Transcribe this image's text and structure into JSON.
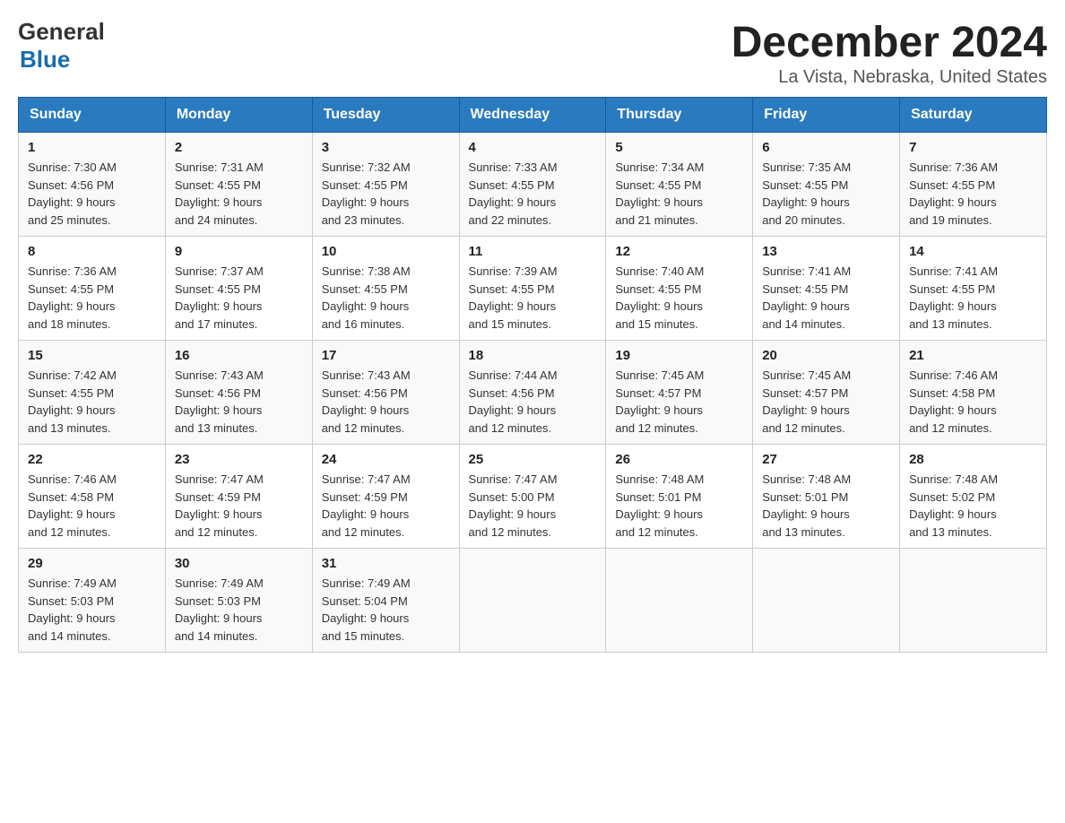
{
  "header": {
    "logo_general": "General",
    "logo_blue": "Blue",
    "month_title": "December 2024",
    "location": "La Vista, Nebraska, United States"
  },
  "days_of_week": [
    "Sunday",
    "Monday",
    "Tuesday",
    "Wednesday",
    "Thursday",
    "Friday",
    "Saturday"
  ],
  "weeks": [
    [
      {
        "day": "1",
        "sunrise": "7:30 AM",
        "sunset": "4:56 PM",
        "daylight": "9 hours and 25 minutes."
      },
      {
        "day": "2",
        "sunrise": "7:31 AM",
        "sunset": "4:55 PM",
        "daylight": "9 hours and 24 minutes."
      },
      {
        "day": "3",
        "sunrise": "7:32 AM",
        "sunset": "4:55 PM",
        "daylight": "9 hours and 23 minutes."
      },
      {
        "day": "4",
        "sunrise": "7:33 AM",
        "sunset": "4:55 PM",
        "daylight": "9 hours and 22 minutes."
      },
      {
        "day": "5",
        "sunrise": "7:34 AM",
        "sunset": "4:55 PM",
        "daylight": "9 hours and 21 minutes."
      },
      {
        "day": "6",
        "sunrise": "7:35 AM",
        "sunset": "4:55 PM",
        "daylight": "9 hours and 20 minutes."
      },
      {
        "day": "7",
        "sunrise": "7:36 AM",
        "sunset": "4:55 PM",
        "daylight": "9 hours and 19 minutes."
      }
    ],
    [
      {
        "day": "8",
        "sunrise": "7:36 AM",
        "sunset": "4:55 PM",
        "daylight": "9 hours and 18 minutes."
      },
      {
        "day": "9",
        "sunrise": "7:37 AM",
        "sunset": "4:55 PM",
        "daylight": "9 hours and 17 minutes."
      },
      {
        "day": "10",
        "sunrise": "7:38 AM",
        "sunset": "4:55 PM",
        "daylight": "9 hours and 16 minutes."
      },
      {
        "day": "11",
        "sunrise": "7:39 AM",
        "sunset": "4:55 PM",
        "daylight": "9 hours and 15 minutes."
      },
      {
        "day": "12",
        "sunrise": "7:40 AM",
        "sunset": "4:55 PM",
        "daylight": "9 hours and 15 minutes."
      },
      {
        "day": "13",
        "sunrise": "7:41 AM",
        "sunset": "4:55 PM",
        "daylight": "9 hours and 14 minutes."
      },
      {
        "day": "14",
        "sunrise": "7:41 AM",
        "sunset": "4:55 PM",
        "daylight": "9 hours and 13 minutes."
      }
    ],
    [
      {
        "day": "15",
        "sunrise": "7:42 AM",
        "sunset": "4:55 PM",
        "daylight": "9 hours and 13 minutes."
      },
      {
        "day": "16",
        "sunrise": "7:43 AM",
        "sunset": "4:56 PM",
        "daylight": "9 hours and 13 minutes."
      },
      {
        "day": "17",
        "sunrise": "7:43 AM",
        "sunset": "4:56 PM",
        "daylight": "9 hours and 12 minutes."
      },
      {
        "day": "18",
        "sunrise": "7:44 AM",
        "sunset": "4:56 PM",
        "daylight": "9 hours and 12 minutes."
      },
      {
        "day": "19",
        "sunrise": "7:45 AM",
        "sunset": "4:57 PM",
        "daylight": "9 hours and 12 minutes."
      },
      {
        "day": "20",
        "sunrise": "7:45 AM",
        "sunset": "4:57 PM",
        "daylight": "9 hours and 12 minutes."
      },
      {
        "day": "21",
        "sunrise": "7:46 AM",
        "sunset": "4:58 PM",
        "daylight": "9 hours and 12 minutes."
      }
    ],
    [
      {
        "day": "22",
        "sunrise": "7:46 AM",
        "sunset": "4:58 PM",
        "daylight": "9 hours and 12 minutes."
      },
      {
        "day": "23",
        "sunrise": "7:47 AM",
        "sunset": "4:59 PM",
        "daylight": "9 hours and 12 minutes."
      },
      {
        "day": "24",
        "sunrise": "7:47 AM",
        "sunset": "4:59 PM",
        "daylight": "9 hours and 12 minutes."
      },
      {
        "day": "25",
        "sunrise": "7:47 AM",
        "sunset": "5:00 PM",
        "daylight": "9 hours and 12 minutes."
      },
      {
        "day": "26",
        "sunrise": "7:48 AM",
        "sunset": "5:01 PM",
        "daylight": "9 hours and 12 minutes."
      },
      {
        "day": "27",
        "sunrise": "7:48 AM",
        "sunset": "5:01 PM",
        "daylight": "9 hours and 13 minutes."
      },
      {
        "day": "28",
        "sunrise": "7:48 AM",
        "sunset": "5:02 PM",
        "daylight": "9 hours and 13 minutes."
      }
    ],
    [
      {
        "day": "29",
        "sunrise": "7:49 AM",
        "sunset": "5:03 PM",
        "daylight": "9 hours and 14 minutes."
      },
      {
        "day": "30",
        "sunrise": "7:49 AM",
        "sunset": "5:03 PM",
        "daylight": "9 hours and 14 minutes."
      },
      {
        "day": "31",
        "sunrise": "7:49 AM",
        "sunset": "5:04 PM",
        "daylight": "9 hours and 15 minutes."
      },
      null,
      null,
      null,
      null
    ]
  ],
  "labels": {
    "sunrise": "Sunrise:",
    "sunset": "Sunset:",
    "daylight": "Daylight:"
  }
}
